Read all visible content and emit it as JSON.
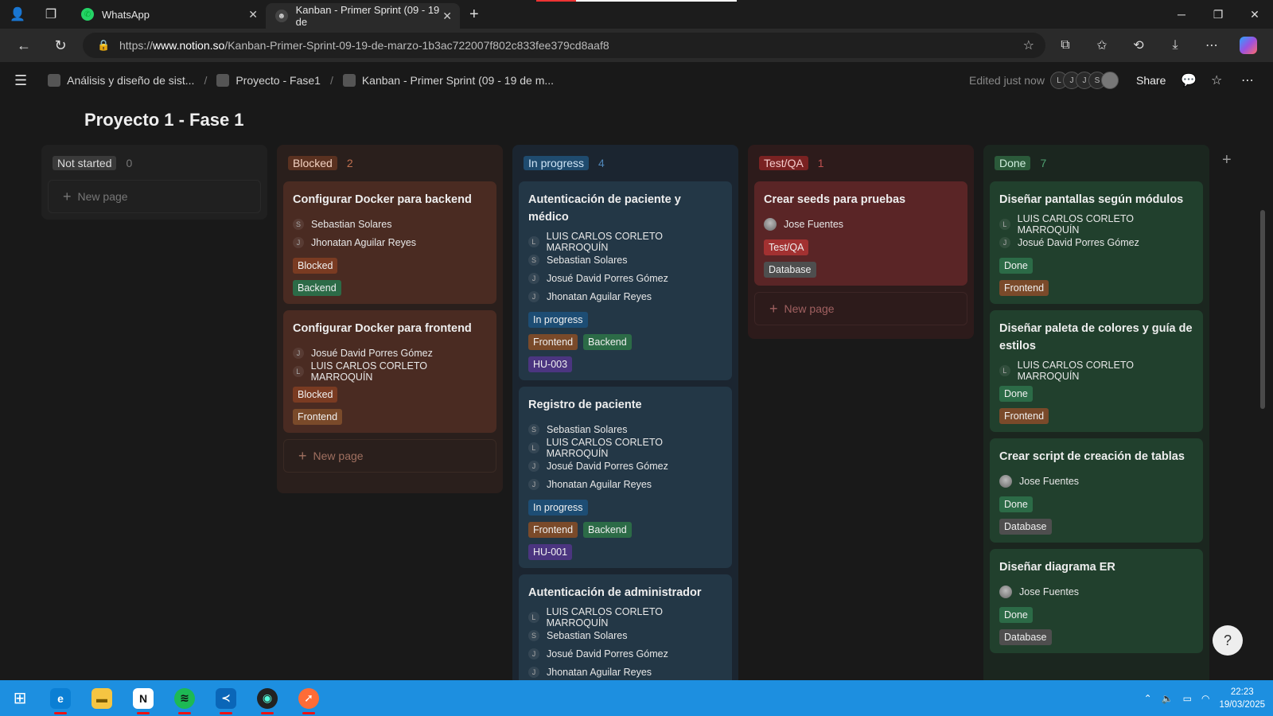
{
  "browser": {
    "tabs": [
      {
        "title": "WhatsApp"
      },
      {
        "title": "Kanban - Primer Sprint (09 - 19 de"
      }
    ],
    "url_prefix": "https://",
    "url_domain": "www.notion.so",
    "url_path": "/Kanban-Primer-Sprint-09-19-de-marzo-1b3ac722007f802c833fee379cd8aaf8"
  },
  "notion": {
    "breadcrumbs": [
      "Análisis y diseño de sist...",
      "Proyecto - Fase1",
      "Kanban - Primer Sprint (09 - 19 de m..."
    ],
    "edited": "Edited just now",
    "avatars": [
      "L",
      "J",
      "J",
      "S"
    ],
    "share_label": "Share",
    "page_title": "Proyecto 1 - Fase 1",
    "new_page": "New page"
  },
  "columns": {
    "not_started": {
      "label": "Not started",
      "count": "0"
    },
    "blocked": {
      "label": "Blocked",
      "count": "2",
      "cards": [
        {
          "title": "Configurar Docker para backend",
          "people": [
            {
              "i": "S",
              "name": "Sebastian Solares"
            },
            {
              "i": "J",
              "name": "Jhonatan Aguilar Reyes"
            }
          ],
          "status": "Blocked",
          "tags": [
            "Backend"
          ]
        },
        {
          "title": "Configurar Docker para frontend",
          "people": [
            {
              "i": "J",
              "name": "Josué David Porres Gómez"
            },
            {
              "i": "L",
              "name": "LUIS CARLOS CORLETO MARROQUÍN"
            }
          ],
          "status": "Blocked",
          "tags": [
            "Frontend"
          ]
        }
      ]
    },
    "in_progress": {
      "label": "In progress",
      "count": "4",
      "cards": [
        {
          "title": "Autenticación de paciente y médico",
          "people": [
            {
              "i": "L",
              "name": "LUIS CARLOS CORLETO MARROQUÍN"
            },
            {
              "i": "S",
              "name": "Sebastian Solares"
            },
            {
              "i": "J",
              "name": "Josué David Porres Gómez"
            },
            {
              "i": "J",
              "name": "Jhonatan Aguilar Reyes"
            }
          ],
          "status": "In progress",
          "tags": [
            "Frontend",
            "Backend"
          ],
          "hu": "HU-003"
        },
        {
          "title": "Registro de paciente",
          "people": [
            {
              "i": "S",
              "name": "Sebastian Solares"
            },
            {
              "i": "L",
              "name": "LUIS CARLOS CORLETO MARROQUÍN"
            },
            {
              "i": "J",
              "name": "Josué David Porres Gómez"
            },
            {
              "i": "J",
              "name": "Jhonatan Aguilar Reyes"
            }
          ],
          "status": "In progress",
          "tags": [
            "Frontend",
            "Backend"
          ],
          "hu": "HU-001"
        },
        {
          "title": "Autenticación de administrador",
          "people": [
            {
              "i": "L",
              "name": "LUIS CARLOS CORLETO MARROQUÍN"
            },
            {
              "i": "S",
              "name": "Sebastian Solares"
            },
            {
              "i": "J",
              "name": "Josué David Porres Gómez"
            },
            {
              "i": "J",
              "name": "Jhonatan Aguilar Reyes"
            }
          ]
        }
      ]
    },
    "test_qa": {
      "label": "Test/QA",
      "count": "1",
      "cards": [
        {
          "title": "Crear seeds para pruebas",
          "people": [
            {
              "name": "Jose Fuentes"
            }
          ],
          "status": "Test/QA",
          "tags": [
            "Database"
          ]
        }
      ]
    },
    "done": {
      "label": "Done",
      "count": "7",
      "cards": [
        {
          "title": "Diseñar pantallas según módulos",
          "people": [
            {
              "i": "L",
              "name": "LUIS CARLOS CORLETO MARROQUÍN"
            },
            {
              "i": "J",
              "name": "Josué David Porres Gómez"
            }
          ],
          "status": "Done",
          "tags": [
            "Frontend"
          ]
        },
        {
          "title": "Diseñar paleta de colores y guía de estilos",
          "people": [
            {
              "i": "L",
              "name": "LUIS CARLOS CORLETO MARROQUÍN"
            }
          ],
          "status": "Done",
          "tags": [
            "Frontend"
          ]
        },
        {
          "title": "Crear script de creación de tablas",
          "people": [
            {
              "name": "Jose Fuentes"
            }
          ],
          "status": "Done",
          "tags": [
            "Database"
          ]
        },
        {
          "title": "Diseñar diagrama ER",
          "people": [
            {
              "name": "Jose Fuentes"
            }
          ],
          "status": "Done",
          "tags": [
            "Database"
          ]
        }
      ]
    }
  },
  "taskbar": {
    "time": "22:23",
    "date": "19/03/2025"
  }
}
